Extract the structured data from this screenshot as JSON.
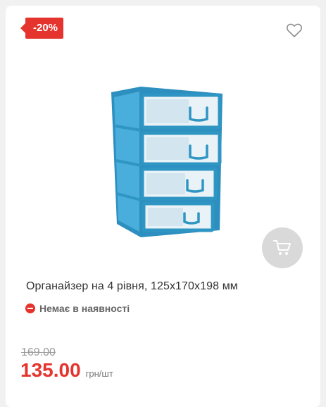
{
  "product": {
    "discount_badge": "-20%",
    "title": "Органайзер на 4 рівня, 125х170х198 мм",
    "stock_status": "Немає в наявності",
    "old_price": "169.00",
    "price": "135.00",
    "price_unit": "грн/шт"
  },
  "icons": {
    "wishlist": "heart-icon",
    "cart": "cart-icon",
    "stock": "minus-circle-icon"
  },
  "colors": {
    "accent": "#e5342d",
    "product_frame": "#2f95c3"
  }
}
